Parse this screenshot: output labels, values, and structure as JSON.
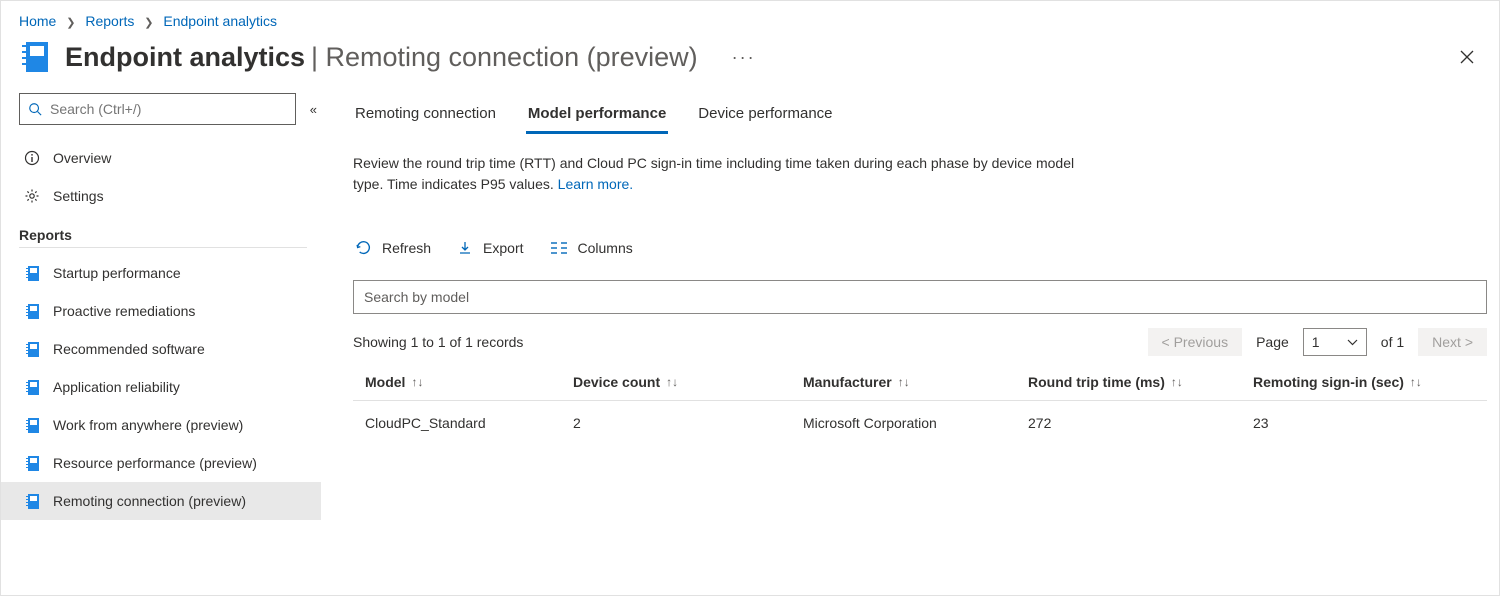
{
  "breadcrumb": [
    {
      "label": "Home"
    },
    {
      "label": "Reports"
    },
    {
      "label": "Endpoint analytics"
    }
  ],
  "header": {
    "title": "Endpoint analytics",
    "subtitle": "Remoting connection (preview)"
  },
  "sidebar": {
    "search_placeholder": "Search (Ctrl+/)",
    "top_items": [
      {
        "icon": "info",
        "label": "Overview"
      },
      {
        "icon": "gear",
        "label": "Settings"
      }
    ],
    "section_label": "Reports",
    "report_items": [
      {
        "label": "Startup performance"
      },
      {
        "label": "Proactive remediations"
      },
      {
        "label": "Recommended software"
      },
      {
        "label": "Application reliability"
      },
      {
        "label": "Work from anywhere (preview)"
      },
      {
        "label": "Resource performance (preview)"
      },
      {
        "label": "Remoting connection (preview)",
        "selected": true
      }
    ]
  },
  "tabs": [
    {
      "label": "Remoting connection"
    },
    {
      "label": "Model performance",
      "active": true
    },
    {
      "label": "Device performance"
    }
  ],
  "description": {
    "text": "Review the round trip time (RTT) and Cloud PC sign-in time including time taken during each phase by device model type. Time indicates P95 values. ",
    "learn_more": "Learn more."
  },
  "toolbar": {
    "refresh": "Refresh",
    "export": "Export",
    "columns": "Columns"
  },
  "filter": {
    "placeholder": "Search by model"
  },
  "showing": "Showing 1 to 1 of 1 records",
  "pager": {
    "prev": "<  Previous",
    "page_label": "Page",
    "page_value": "1",
    "of_label": "of 1",
    "next": "Next  >"
  },
  "table": {
    "headers": {
      "model": "Model",
      "count": "Device count",
      "mfr": "Manufacturer",
      "rtt": "Round trip time (ms)",
      "signin": "Remoting sign-in (sec)"
    },
    "rows": [
      {
        "model": "CloudPC_Standard",
        "count": "2",
        "mfr": "Microsoft Corporation",
        "rtt": "272",
        "signin": "23"
      }
    ]
  }
}
